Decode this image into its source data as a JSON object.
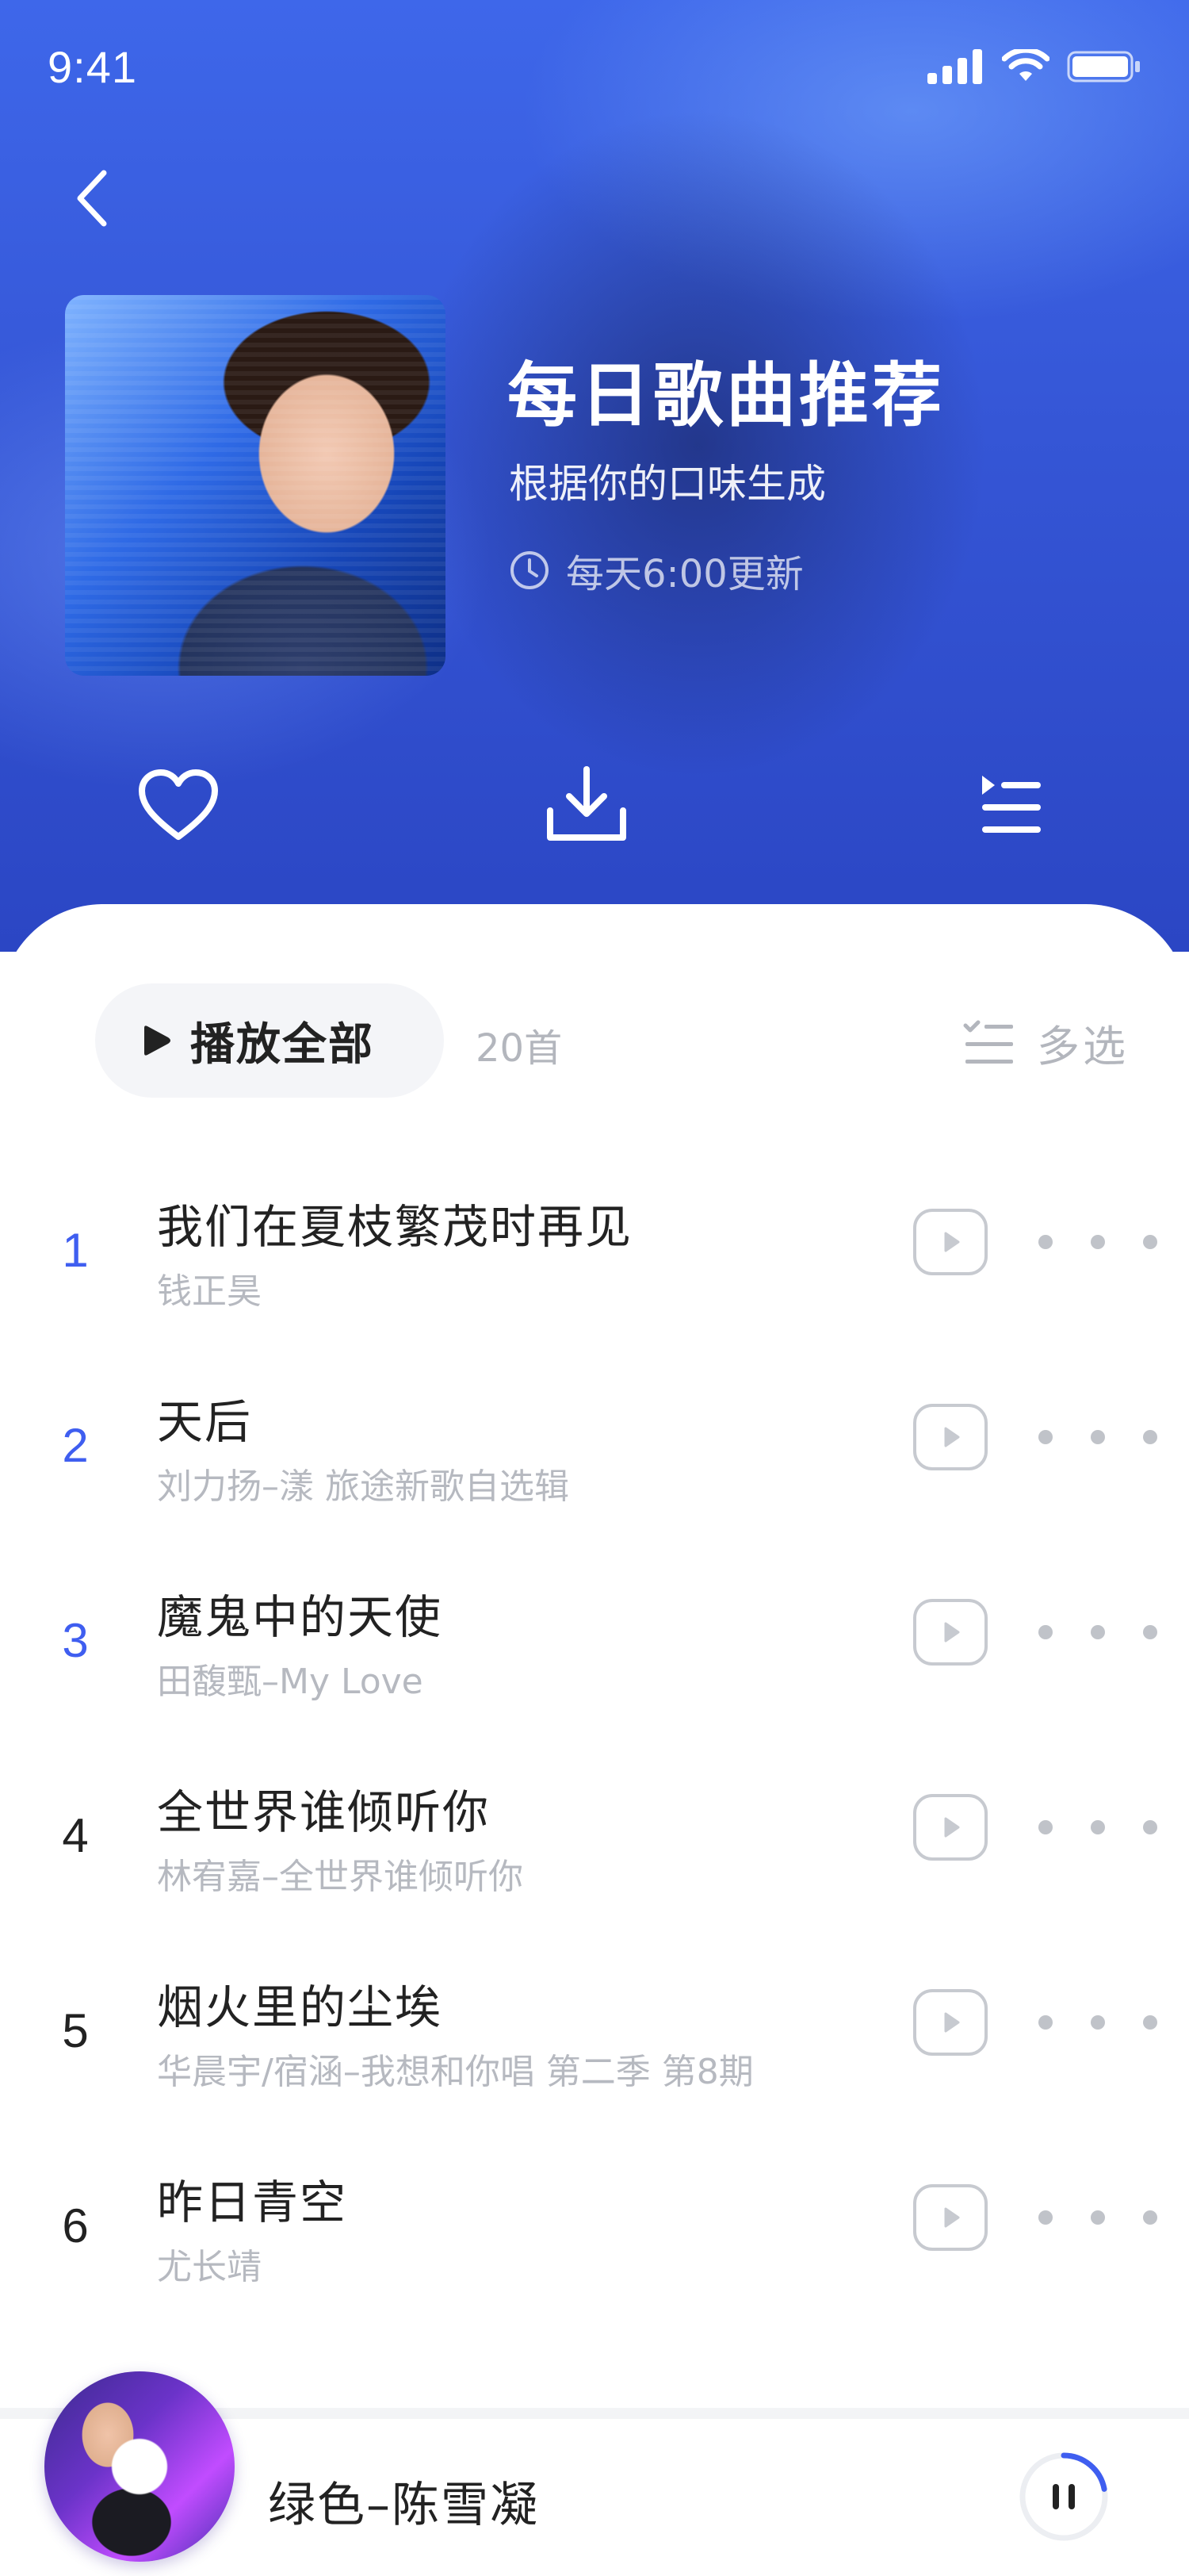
{
  "status_bar": {
    "time": "9:41"
  },
  "playlist": {
    "title": "每日歌曲推荐",
    "subtitle": "根据你的口味生成",
    "update_text": "每天6:00更新"
  },
  "actions": [
    "heart-icon",
    "download-icon",
    "playlist-icon"
  ],
  "list_header": {
    "play_all_label": "播放全部",
    "count": "20首",
    "multi_select_label": "多选"
  },
  "songs": [
    {
      "num": "1",
      "title": "我们在夏枝繁茂时再见",
      "artist": "钱正昊",
      "highlight": true
    },
    {
      "num": "2",
      "title": "天后",
      "artist": "刘力扬–漾 旅途新歌自选辑",
      "highlight": true
    },
    {
      "num": "3",
      "title": "魔鬼中的天使",
      "artist": "田馥甄–My Love",
      "highlight": true
    },
    {
      "num": "4",
      "title": "全世界谁倾听你",
      "artist": "林宥嘉–全世界谁倾听你",
      "highlight": false
    },
    {
      "num": "5",
      "title": "烟火里的尘埃",
      "artist": "华晨宇/宿涵–我想和你唱 第二季 第8期",
      "highlight": false
    },
    {
      "num": "6",
      "title": "昨日青空",
      "artist": "尤长靖",
      "highlight": false
    }
  ],
  "mini_player": {
    "title": "绿色–陈雪凝",
    "progress": 0.22
  },
  "colors": {
    "accent": "#3f5ef0",
    "header_bg": "#3556d6",
    "muted": "#b6b9c0"
  }
}
